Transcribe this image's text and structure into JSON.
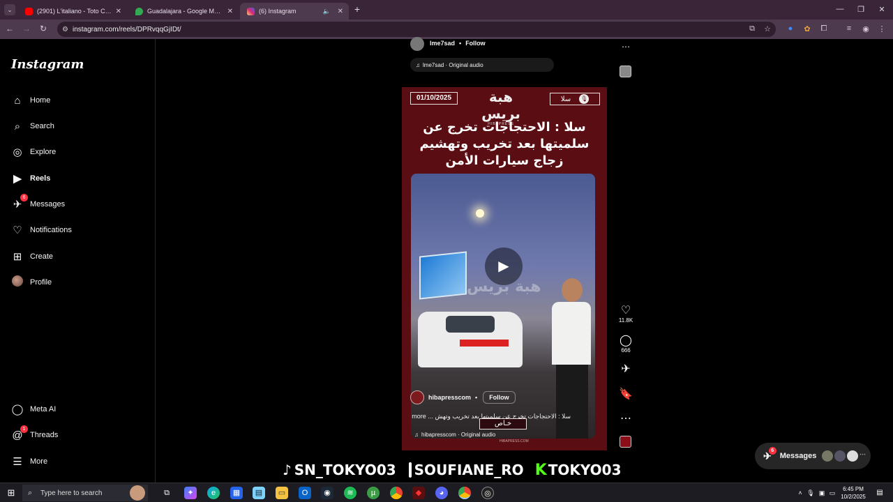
{
  "browser": {
    "tabs": [
      {
        "title": "(2901) L'italiano - Toto Cutugno",
        "icon_color": "#ff0000",
        "icon": "youtube-icon"
      },
      {
        "title": "Guadalajara - Google Maps",
        "icon_color": "#34a853",
        "icon": "maps-pin-icon"
      },
      {
        "title": "(6) Instagram",
        "icon_color": "#d6249f",
        "icon": "instagram-icon"
      }
    ],
    "url": "instagram.com/reels/DPRvqqGjIDt/"
  },
  "sidebar": {
    "logo": "Instagram",
    "items": [
      {
        "label": "Home",
        "icon": "⌂"
      },
      {
        "label": "Search",
        "icon": "⌕"
      },
      {
        "label": "Explore",
        "icon": "◎"
      },
      {
        "label": "Reels",
        "icon": "▶"
      },
      {
        "label": "Messages",
        "icon": "✈",
        "badge": "6"
      },
      {
        "label": "Notifications",
        "icon": "♡"
      },
      {
        "label": "Create",
        "icon": "⊞"
      },
      {
        "label": "Profile",
        "icon": ""
      }
    ],
    "bottom": [
      {
        "label": "Meta AI",
        "icon": "◯"
      },
      {
        "label": "Threads",
        "icon": "@",
        "badge": "1"
      },
      {
        "label": "More",
        "icon": "☰"
      }
    ]
  },
  "prev_reel": {
    "username": "lme7sad",
    "follow": "Follow",
    "audio": "lme7sad · Original audio"
  },
  "reel": {
    "date": "01/10/2025",
    "brand": "هبة بريس",
    "brand_sub": "HIBAPRESS",
    "city_tag": "سلا",
    "headline": "سلا : الاحتجاجات تخرج عن سلميتها بعد تخريب وتهشيم زجاج سيارات الأمن",
    "watermark": "هبة بريس",
    "username": "hibapresscom",
    "follow": "Follow",
    "caption": "سلا : الاحتجاجات تخرج عن سلميتها بعد تخريب وتهش ... more",
    "exclusive": "خـاص",
    "audio": "hibapresscom · Original audio",
    "footer": "HIBAPRESS.COM",
    "likes": "11.8K",
    "comments": "666"
  },
  "overlay": {
    "tiktok": "SN_TOKYO03",
    "instagram": "SOUFIANE_RO",
    "kick": "TOKYO03"
  },
  "messages_pill": {
    "label": "Messages",
    "badge": "6"
  },
  "taskbar": {
    "search_placeholder": "Type here to search",
    "time": "6:45 PM",
    "date": "10/2/2025"
  }
}
